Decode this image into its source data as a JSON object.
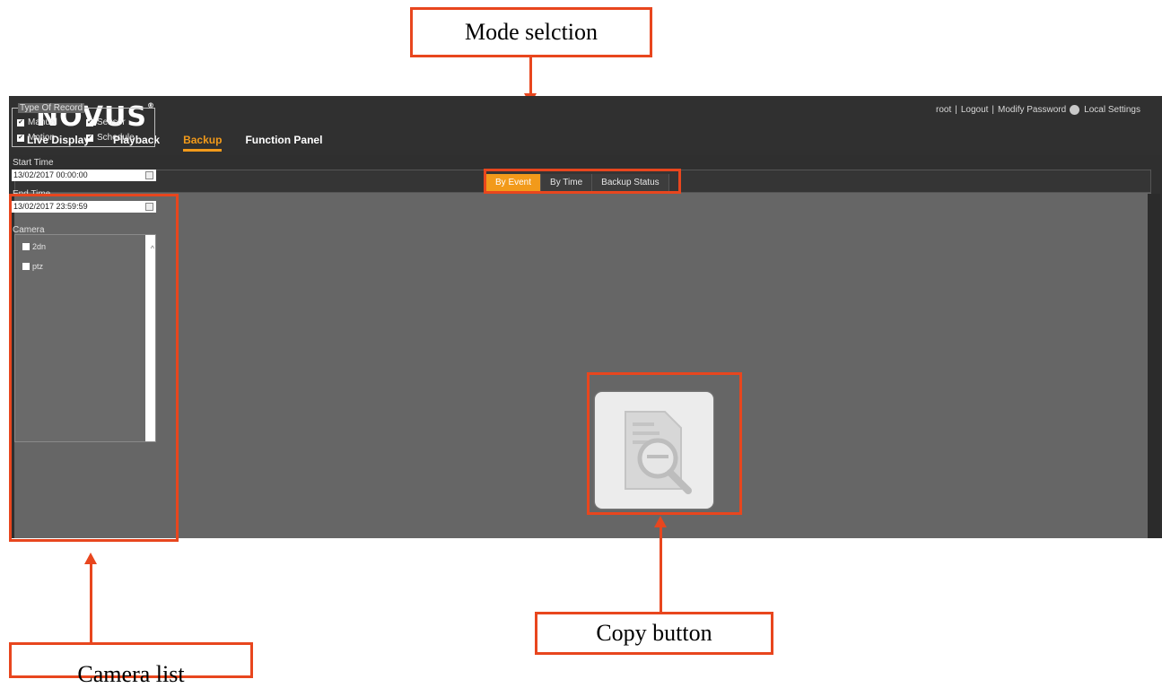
{
  "annotations": {
    "mode_selection": "Mode selction",
    "camera_list": "Camera list",
    "copy_button": "Copy button"
  },
  "app": {
    "logo": "NOVUS",
    "logo_mark": "®",
    "nav": [
      "Live Display",
      "Playback",
      "Backup",
      "Function Panel"
    ],
    "active_nav": "Backup",
    "user": "root",
    "logout": "Logout",
    "modify_password": "Modify Password",
    "local_settings": "Local Settings",
    "mode_tabs": [
      "By Event",
      "By Time",
      "Backup Status"
    ],
    "active_mode": "By Event",
    "accent_color": "#f29a1a"
  },
  "filters": {
    "type_of_record_label": "Type Of Record",
    "record_types": [
      {
        "label": "Manual",
        "checked": true
      },
      {
        "label": "Sensor",
        "checked": true
      },
      {
        "label": "Motion",
        "checked": true
      },
      {
        "label": "Schedule",
        "checked": true
      }
    ],
    "start_time_label": "Start Time",
    "start_time": "13/02/2017 00:00:00",
    "end_time_label": "End Time",
    "end_time": "13/02/2017 23:59:59",
    "camera_label": "Camera",
    "cameras": [
      {
        "label": "2dn",
        "checked": false
      },
      {
        "label": "ptz",
        "checked": false
      }
    ]
  },
  "icons": {
    "copy": "search-document-icon",
    "calendar": "calendar-icon",
    "settings": "gear-icon"
  }
}
